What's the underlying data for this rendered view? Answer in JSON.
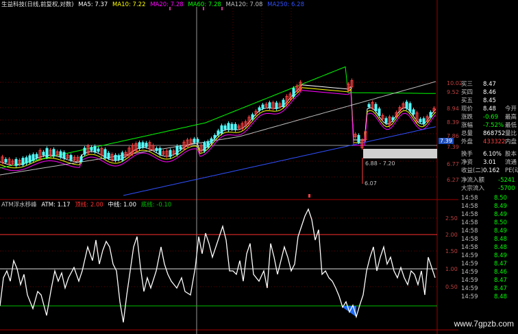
{
  "header": {
    "stock": "生益科技(日线,前复权,对数)",
    "ma5": "MA5: 7.37",
    "ma10": "MA10: 7.22",
    "ma20": "MA20: 7.28",
    "ma60": "MA60: 7.28",
    "ma120": "MA120: 7.08",
    "ma250": "MA250: 6.28"
  },
  "indicator": {
    "name": "ATM浮水移峰",
    "atm": "ATM: 1.17",
    "top": "顶线: 2.00",
    "mid": "中线: 1.00",
    "bottom": "底线: -0.10"
  },
  "price_axis": [
    "10.02",
    "9.52",
    "8.94",
    "8.39",
    "7.86",
    "7.39",
    "6.77",
    "6.27"
  ],
  "ind_axis": [
    "2.50",
    "2.00",
    "1.50",
    "1.00",
    "0.50"
  ],
  "price_marker": "7.39",
  "annotations": {
    "range": "6.88 - 7.20",
    "low": "6.07"
  },
  "orderbook": [
    {
      "label": "买三",
      "value": "8.47"
    },
    {
      "label": "买四",
      "value": "8.46"
    },
    {
      "label": "买五",
      "value": "8.45"
    }
  ],
  "stats": [
    {
      "label": "现价",
      "value": "8.48",
      "extra": "今开"
    },
    {
      "label": "涨跌",
      "value": "-0.69",
      "extra": "最高"
    },
    {
      "label": "涨幅",
      "value": "-7.52%",
      "extra": "最低"
    },
    {
      "label": "总量",
      "value": "868752",
      "extra": "量比"
    },
    {
      "label": "外盘",
      "value": "433322",
      "extra": "内盘"
    },
    {
      "label": "换手",
      "value": "6.10%",
      "extra": "股本"
    },
    {
      "label": "净资",
      "value": "3.01",
      "extra": "流通"
    },
    {
      "label": "收益(二)",
      "value": "0.162",
      "extra": "PE(动)"
    }
  ],
  "flows": [
    {
      "label": "净流入额",
      "value": "-5241"
    },
    {
      "label": "大宗流入",
      "value": "-5700"
    }
  ],
  "ticks": [
    {
      "time": "14:58",
      "price": "8.50"
    },
    {
      "time": "14:58",
      "price": "8.49"
    },
    {
      "time": "14:58",
      "price": "8.49"
    },
    {
      "time": "14:58",
      "price": "8.50"
    },
    {
      "time": "14:58",
      "price": "8.49"
    },
    {
      "time": "14:58",
      "price": "8.48"
    },
    {
      "time": "14:58",
      "price": "8.48"
    },
    {
      "time": "14:59",
      "price": "8.49"
    },
    {
      "time": "14:59",
      "price": "8.47"
    },
    {
      "time": "14:59",
      "price": "8.46"
    },
    {
      "time": "14:59",
      "price": "8.47"
    },
    {
      "time": "14:59",
      "price": "8.47"
    },
    {
      "time": "14:59",
      "price": "8.48"
    }
  ],
  "watermark": "www.7gpzb.com",
  "colors": {
    "up": "#ff4040",
    "down": "#54ffff",
    "ma5": "#ffffff",
    "ma10": "#ffff00",
    "ma20": "#ff00ff",
    "ma60": "#00ff00",
    "ma120": "#c0c0c0",
    "ma250": "#3050ff",
    "grid": "#8b0000"
  }
}
